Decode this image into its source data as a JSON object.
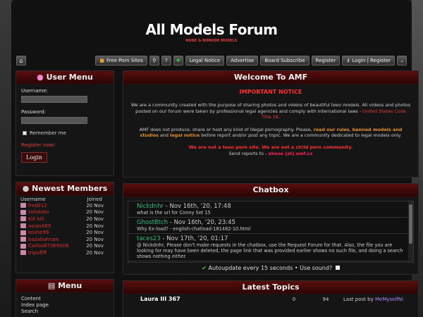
{
  "site": {
    "logo": "All Models Forum",
    "tagline": "NUDE & NONUDE MODELS"
  },
  "nav": {
    "free_porn": "Free Porn Sites",
    "legal": "Legal Notice",
    "advertise": "Advertise",
    "board_sub": "Board Subscribe",
    "register": "Register",
    "login": "Login | Register"
  },
  "usermenu": {
    "title": "User Menu",
    "username_label": "Username:",
    "password_label": "Password:",
    "remember": "Remember me",
    "register_now": "Register now!",
    "login_button": "Login"
  },
  "members": {
    "title": "Newest Members",
    "col_user": "Username",
    "col_joined": "Joined",
    "list": [
      {
        "name": "fredil12",
        "date": "20 Nov"
      },
      {
        "name": "solokoto",
        "date": "20 Nov"
      },
      {
        "name": "Kill kill",
        "date": "20 Nov"
      },
      {
        "name": "asianX69",
        "date": "20 Nov"
      },
      {
        "name": "koshe99",
        "date": "20 Nov"
      },
      {
        "name": "bazabahram",
        "date": "20 Nov"
      },
      {
        "name": "Carlos87069008",
        "date": "20 Nov"
      },
      {
        "name": "tripoffff",
        "date": "20 Nov"
      }
    ]
  },
  "menu": {
    "title": "Menu",
    "items": [
      "Content",
      "Index page",
      "Search"
    ]
  },
  "welcome": {
    "title": "Welcome To AMF",
    "notice_title": "IMPORTANT NOTICE",
    "p1": "We are a community created with the purpose of sharing photos and videos of beautiful teen models. All videos and photos posted on our forum were taken by professional legal agencies and comply with international laws -",
    "p1_link": "United States Code Title 18.",
    "p2_a": "AMF does not produce, share or host any kind of illegal pornography. Please,",
    "p2_rules": "read our rules",
    "p2_comma": ",",
    "p2_banned": "banned models and studios",
    "p2_and": "and",
    "p2_legal": "legal notice",
    "p2_b": "before report and/or post any topic. We are a community dedicated to legal models only.",
    "warning": "We are not a teen porn site. We are not a ch!ld porn community.",
    "report_prefix": "Send reports to -",
    "report_email": "abuse (at) amf.cx"
  },
  "chatbox": {
    "title": "Chatbox",
    "messages": [
      {
        "user": "Nickdnhr",
        "meta": " - Nov 16th, '20, 17:48",
        "color": "#3cb878",
        "text": "what is the url for Conny Set 15"
      },
      {
        "user": "GhostBtch",
        "meta": " - Nov 16th, '20, 23:45",
        "color": "#3cb878",
        "text": "Why Ex-load? - english-chatload-181482-10.html"
      },
      {
        "user": "taces23",
        "meta": " - Nov 17th, '20, 01:17",
        "color": "#3cb878",
        "text": "@ Nickdnhr, Please don't make requests in the chatbox, use the Request Forum for that. Also, the file you are looking for may have been deleted, the page link that was provided earlier shows no such file, and doing a search shows nothing either."
      }
    ],
    "autoupdate": "Autoupdate every 15 seconds • Use sound?"
  },
  "latest": {
    "title": "Latest Topics",
    "topic_title": "Laura III 367",
    "replies": "0",
    "views": "94",
    "last_post": "Last post by",
    "last_user": "MeMyselfNi"
  }
}
